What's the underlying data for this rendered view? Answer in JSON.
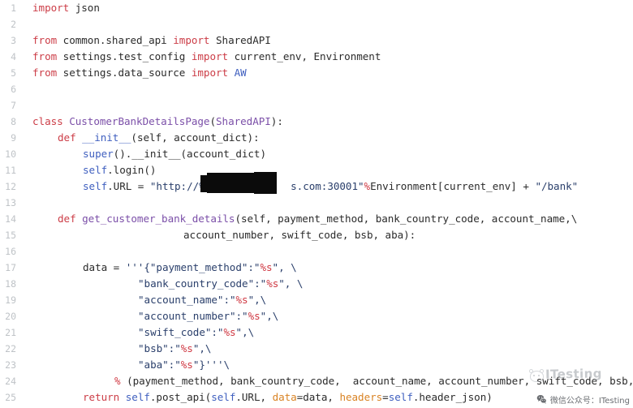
{
  "editor": {
    "language": "Python",
    "background_color": "#ffffff",
    "line_number_color": "#bfc3c7",
    "colors": {
      "keyword": "#cc3d47",
      "self": "#3f5fbf",
      "class_name": "#7b4fa8",
      "string": "#2a3f6b",
      "percent_spec": "#d03a44",
      "kwarg": "#d98324",
      "plain": "#2b2b2b"
    },
    "line_numbers": [
      "1",
      "2",
      "3",
      "4",
      "5",
      "6",
      "7",
      "8",
      "9",
      "10",
      "11",
      "12",
      "13",
      "14",
      "15",
      "16",
      "17",
      "18",
      "19",
      "20",
      "21",
      "22",
      "23",
      "24",
      "25"
    ],
    "lines": {
      "l1": "import json",
      "l2": "",
      "l3": "from common.shared_api import SharedAPI",
      "l4": "from settings.test_config import current_env, Environment",
      "l5": "from settings.data_source import AW",
      "l6": "",
      "l7": "",
      "l8": "class CustomerBankDetailsPage(SharedAPI):",
      "l9": "    def __init__(self, account_dict):",
      "l10": "        super().__init__(account_dict)",
      "l11": "        self.login()",
      "l12": "        self.URL = \"http://%s.████████.com:30001\"%Environment[current_env] + \"/bank\"",
      "l13": "",
      "l14": "    def get_customer_bank_details(self, payment_method, bank_country_code, account_name,\\",
      "l15": "                                  account_number, swift_code, bsb, aba):",
      "l16": "",
      "l17": "        data = '''{\"payment_method\":\"%s\", \\",
      "l18": "                \"bank_country_code\":\"%s\", \\",
      "l19": "                \"account_name\":\"%s\",\\",
      "l20": "                \"account_number\":\"%s\",\\",
      "l21": "                \"swift_code\":\"%s\",\\",
      "l22": "                \"bsb\":\"%s\",\\",
      "l23": "                \"aba\":\"%s\"}'''\\",
      "l24": "             % (payment_method, bank_country_code,  account_name, account_number, swift_code, bsb, aba)",
      "l25": "        return self.post_api(self.URL, data=data, headers=self.header_json)"
    },
    "tokens": {
      "kw_import": "import",
      "kw_from": "from",
      "kw_class": "class",
      "kw_def": "def",
      "kw_return": "return",
      "mod_json": " json",
      "mod_common": " common.shared_api ",
      "name_sharedapi": " SharedAPI",
      "mod_settings_test": " settings.test_config ",
      "name_currentenv": " current_env, Environment",
      "mod_settings_data": " settings.data_source ",
      "name_aw": " AW",
      "class_name": " CustomerBankDetailsPage",
      "class_base_open": "(",
      "class_base": "SharedAPI",
      "class_base_close": "):",
      "def_init": " __init__",
      "init_args": "(self, account_dict):",
      "super_call": "super",
      "super_rest": "().__init__(account_dict)",
      "self_word": "self",
      "login_call": ".login()",
      "url_assign": ".URL = ",
      "url_str_open": "\"http://%s.",
      "url_str_close": ".com:30001\"",
      "percent": "%",
      "env_expr": "Environment[current_env] + ",
      "bank_str": "\"/bank\"",
      "def_getdetails": " get_customer_bank_details",
      "getdetails_args": "(self, payment_method, bank_country_code, account_name,\\",
      "getdetails_args2": "account_number, swift_code, bsb, aba):",
      "data_assign": "data = ",
      "tq_open": "'''{",
      "k_payment": "\"payment_method\":\"",
      "s_spec": "%s",
      "tail_comma_bs": "\", \\",
      "k_bankcountry": "\"bank_country_code\":\"",
      "k_accountname": "\"account_name\":\"",
      "tail_comma_bs2": "\",\\",
      "k_accountnumber": "\"account_number\":\"",
      "k_swift": "\"swift_code\":\"",
      "k_bsb": "\"bsb\":\"",
      "k_aba": "\"aba\":\"",
      "tail_close": "\"}'''\\",
      "fmt_args": " (payment_method, bank_country_code,  account_name, account_number, swift_code, bsb, aba)",
      "post_api": ".post_api(",
      "self_url": ".URL, ",
      "kwarg_data": "data",
      "eq_data": "=data, ",
      "kwarg_headers": "headers",
      "eq_self": "=",
      "header_json": ".header_json)"
    },
    "redactions": [
      {
        "name": "redaction-box-left"
      },
      {
        "name": "redaction-box-center"
      },
      {
        "name": "redaction-box-right"
      }
    ]
  },
  "watermark": {
    "text": "ITesting",
    "logo": "cat-face-icon",
    "color": "#9aa0a6"
  },
  "badge": {
    "icon": "wechat-icon",
    "text": "微信公众号：ITesting"
  }
}
